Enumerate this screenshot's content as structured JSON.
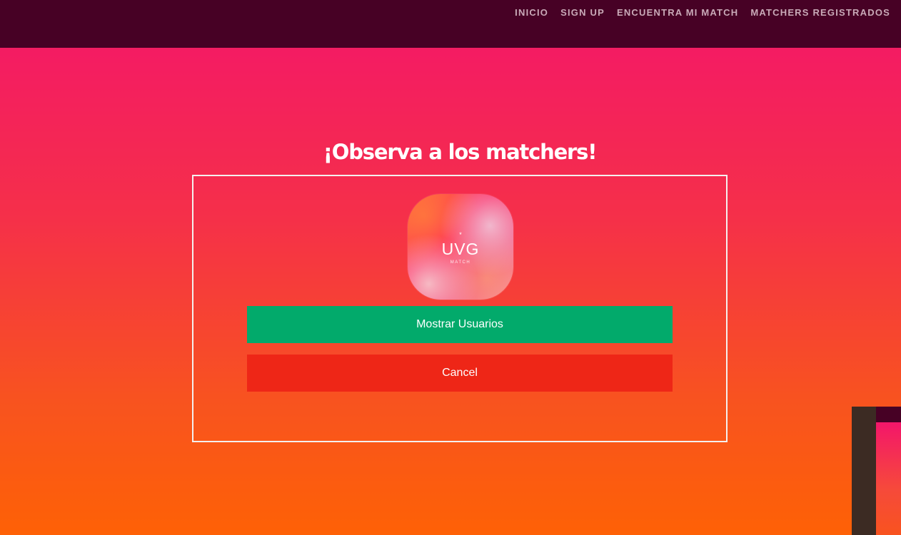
{
  "nav": {
    "items": [
      "INICIO",
      "SIGN UP",
      "ENCUENTRA MI MATCH",
      "MATCHERS REGISTRADOS"
    ]
  },
  "page": {
    "title": "¡Observa a los matchers!"
  },
  "logo": {
    "star": "*",
    "text": "UVG",
    "subtext": "MATCH"
  },
  "buttons": {
    "show_users": "Mostrar Usuarios",
    "cancel": "Cancel"
  },
  "colors": {
    "navbar": "#470125",
    "gradient_top": "#f3166a",
    "gradient_bottom": "#fe6106",
    "show_button": "#02aa6b",
    "cancel_button": "#ee2617"
  }
}
